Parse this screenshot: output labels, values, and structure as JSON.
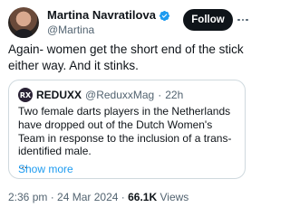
{
  "author": {
    "display_name": "Martina Navratilova",
    "handle": "@Martina"
  },
  "follow_label": "Follow",
  "tweet_text": "Again- women get the short end of the stick either way. And it stinks.",
  "quoted": {
    "avatar_text": "RX",
    "name": "REDUXX",
    "handle": "@ReduxxMag",
    "separator": "·",
    "time": "22h",
    "text": "Two female darts players in the Netherlands have dropped out of the Dutch Women's Team in response to the inclusion of a trans-identified male.",
    "ellipsis": "...",
    "show_more": "Show more"
  },
  "footer": {
    "time": "2:36 pm",
    "separator1": "·",
    "date": "24 Mar 2024",
    "separator2": "·",
    "views_count": "66.1K",
    "views_label": "Views"
  },
  "colors": {
    "verified": "#1d9bf0",
    "link": "#1d9bf0",
    "secondary_text": "#536471"
  }
}
